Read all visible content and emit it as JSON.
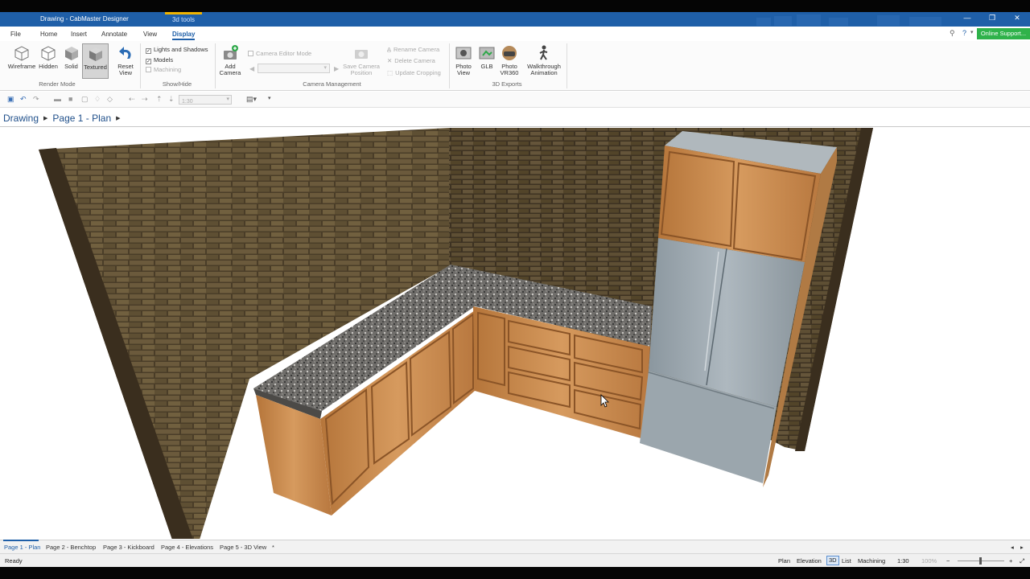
{
  "window": {
    "title": "Drawing - CabMaster Designer",
    "context_tab": "3d tools",
    "controls": [
      "—",
      "❐",
      "✕"
    ]
  },
  "menu": {
    "items": [
      "File",
      "Home",
      "Insert",
      "Annotate",
      "View",
      "Display"
    ],
    "active": "Display",
    "online_support": "Online Support..."
  },
  "ribbon": {
    "render_mode": {
      "buttons": [
        "Wireframe",
        "Hidden",
        "Solid",
        "Textured"
      ],
      "selected": "Textured",
      "group_label": "Render Mode"
    },
    "reset_view": {
      "line1": "Reset",
      "line2": "View"
    },
    "show_hide": {
      "options": [
        {
          "label": "Lights and Shadows",
          "checked": true
        },
        {
          "label": "Models",
          "checked": true
        },
        {
          "label": "Machining",
          "checked": false
        }
      ],
      "group_label": "Show/Hide"
    },
    "camera": {
      "add_line1": "Add",
      "add_line2": "Camera",
      "editor_mode": "Camera Editor Mode",
      "save_line1": "Save Camera",
      "save_line2": "Position",
      "rename": "Rename Camera",
      "delete": "Delete Camera",
      "update": "Update Cropping",
      "group_label": "Camera Management"
    },
    "exports": {
      "photo_view": [
        "Photo",
        "View"
      ],
      "glb": "GLB",
      "photo_vr": [
        "Photo",
        "VR360"
      ],
      "walkthrough": [
        "Walkthrough",
        "Animation"
      ],
      "group_label": "3D Exports"
    }
  },
  "qat": {
    "scale_combo": "1:30"
  },
  "breadcrumb": {
    "root": "Drawing",
    "page": "Page 1 - Plan"
  },
  "page_tabs": [
    "Page 1 - Plan",
    "Page 2 - Benchtop",
    "Page 3 - Kickboard",
    "Page 4 - Elevations",
    "Page 5 - 3D View",
    "*"
  ],
  "status": {
    "text": "Ready",
    "views": [
      "Plan",
      "Elevation",
      "3D",
      "List",
      "Machining"
    ],
    "active_view": "3D",
    "scale": "1:30",
    "zoom": "100%"
  },
  "colors": {
    "titlebar": "#1f5fa8",
    "accent": "#1f5fa8",
    "online_support": "#2fb24a",
    "brick": "#5a4a30",
    "timber": "#c8884a",
    "fridge": "#9aa6ae",
    "granite": "#6a6a6a"
  }
}
